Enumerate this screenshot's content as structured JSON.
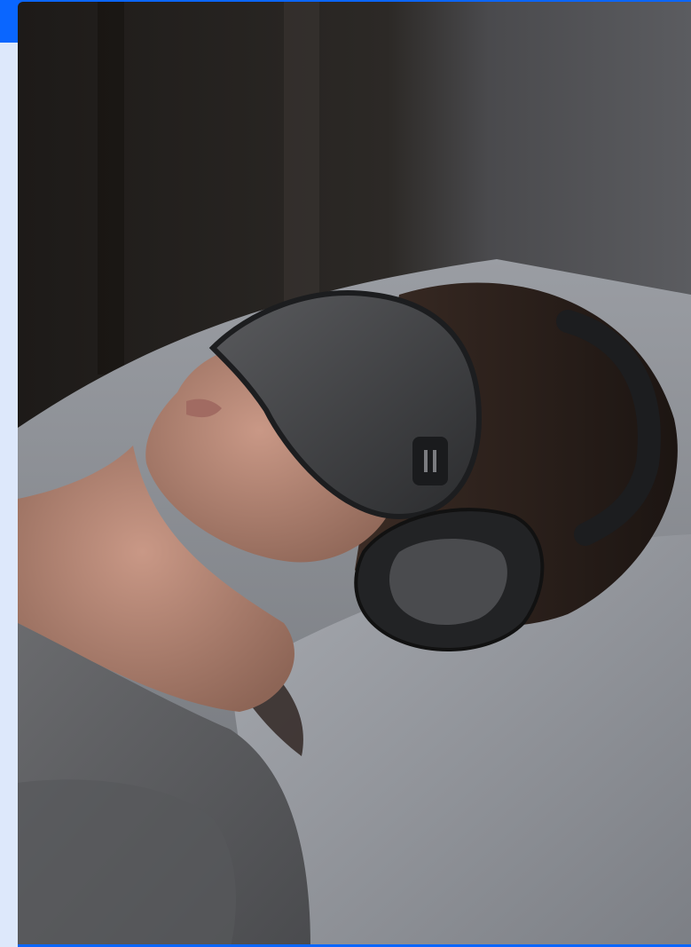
{
  "image": {
    "description_alt": "",
    "accent_color": "#0a66ff",
    "background_color": "#dfe9fb"
  }
}
